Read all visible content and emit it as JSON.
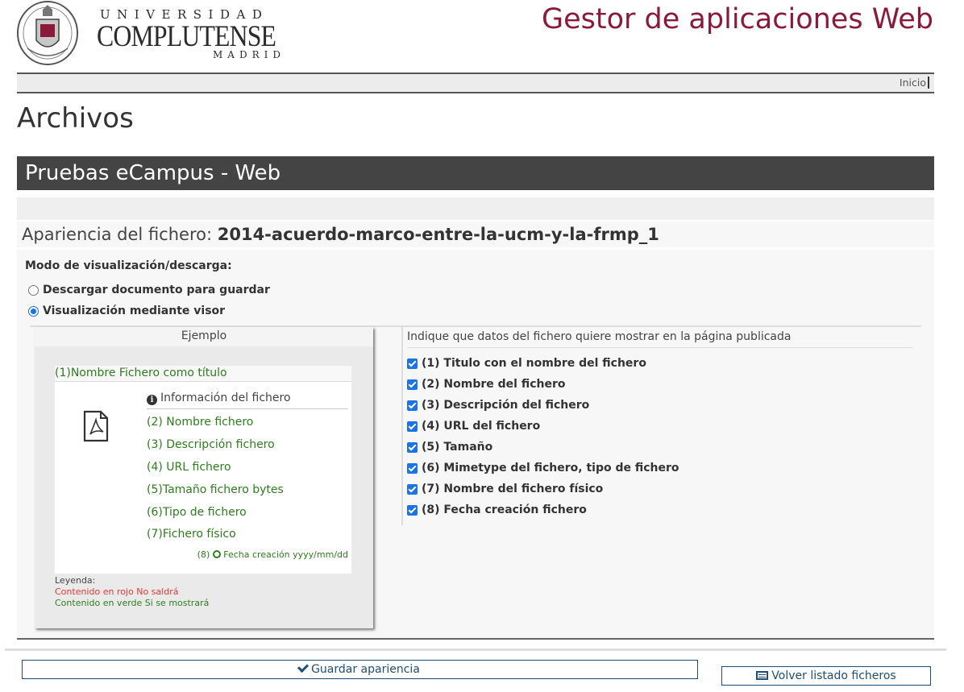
{
  "header": {
    "logo_line1": "UNIVERSIDAD",
    "logo_line2": "COMPLUTENSE",
    "logo_line3": "MADRID",
    "app_title": "Gestor de aplicaciones Web"
  },
  "topbar": {
    "home_link": "Inicio"
  },
  "page": {
    "title": "Archivos",
    "site_name": "Pruebas eCampus - Web",
    "file_appearance_label": "Apariencia del fichero:",
    "file_name": "2014-acuerdo-marco-entre-la-ucm-y-la-frmp_1"
  },
  "mode": {
    "label": "Modo de visualización/descarga:",
    "options": [
      {
        "label": "Descargar documento para guardar",
        "selected": false
      },
      {
        "label": "Visualización mediante visor",
        "selected": true
      }
    ]
  },
  "example": {
    "title": "Ejemplo",
    "name_as_title": "(1)Nombre Fichero como título",
    "info_heading": "Información del fichero",
    "fields": [
      "(2) Nombre fichero",
      "(3) Descripción fichero",
      "(4) URL fichero",
      "(5)Tamaño fichero bytes",
      "(6)Tipo de fichero",
      "(7)Fichero físico"
    ],
    "date_prefix": "(8)",
    "date_label": "Fecha creación yyyy/mm/dd",
    "legend_title": "Leyenda:",
    "legend_red": "Contenido en rojo No saldrá",
    "legend_green": "Contenido en verde Si se mostrará"
  },
  "options": {
    "heading": "Indique que datos del fichero quiere mostrar en la página publicada",
    "items": [
      {
        "label": "(1) Titulo con el nombre del fichero",
        "checked": true
      },
      {
        "label": "(2) Nombre del fichero",
        "checked": true
      },
      {
        "label": "(3) Descripción del fichero",
        "checked": true
      },
      {
        "label": "(4) URL del fichero",
        "checked": true
      },
      {
        "label": "(5) Tamaño",
        "checked": true
      },
      {
        "label": "(6) Mimetype del fichero, tipo de fichero",
        "checked": true
      },
      {
        "label": "(7) Nombre del fichero físico",
        "checked": true
      },
      {
        "label": "(8) Fecha creación fichero",
        "checked": true
      }
    ]
  },
  "buttons": {
    "save": "Guardar apariencia",
    "back": "Volver listado ficheros"
  },
  "colors": {
    "brand": "#8b1a3a",
    "site_bar": "#444444",
    "green": "#2e7d1e",
    "red": "#e53935",
    "checkbox": "#1a73e8",
    "button": "#1f4e79"
  }
}
